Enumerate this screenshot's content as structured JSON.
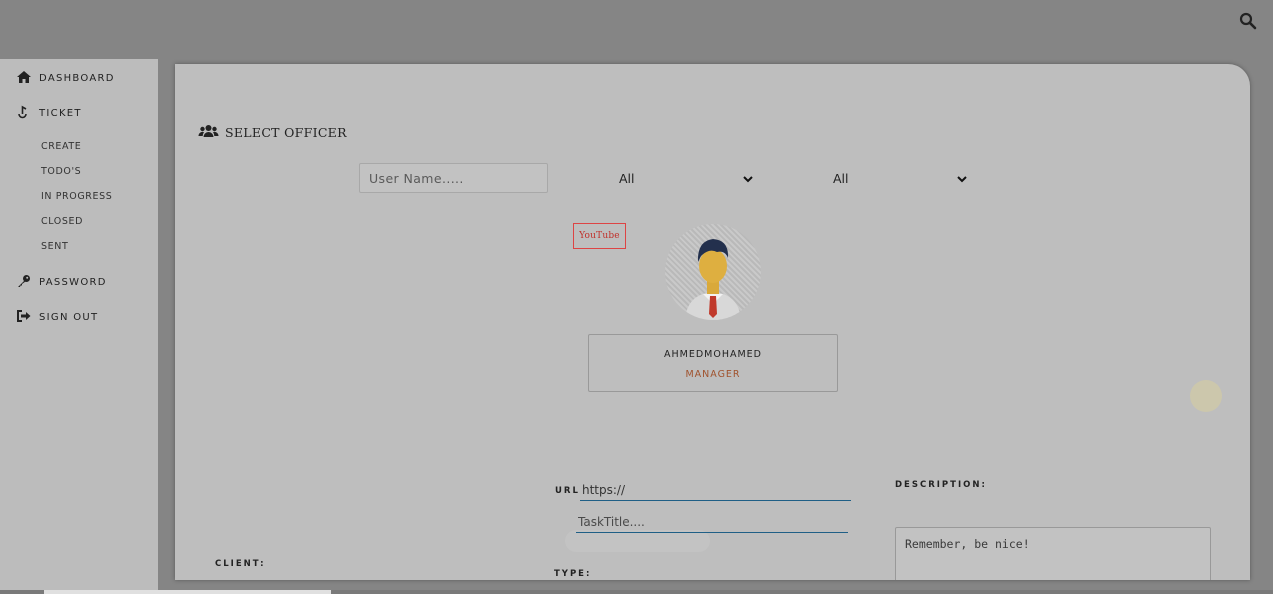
{
  "sidebar": {
    "dashboard": "DASHBOARD",
    "ticket": "TICKET",
    "ticket_items": [
      "CREATE",
      "TODO'S",
      "IN PROGRESS",
      "CLOSED",
      "SENT"
    ],
    "password": "PASSWORD",
    "sign_out": "SIGN OUT"
  },
  "main": {
    "title": "SELECT OFFICER",
    "username_placeholder": "User Name.....",
    "filter1_value": "All",
    "filter2_value": "All",
    "badge": "YouTube",
    "profile": {
      "name": "AHMEDMOHAMED",
      "role": "MANAGER"
    },
    "url_label": "URL",
    "url_value": "https://",
    "task_placeholder": "TaskTitle....",
    "description_label": "DESCRIPTION:",
    "description_placeholder": "Remember, be nice!",
    "client_label": "CLIENT:",
    "type_label": "TYPE:"
  },
  "icons": {
    "search": "search-icon",
    "home": "home-icon",
    "ticket": "ticket-icon",
    "key": "key-icon",
    "signout": "sign-out-icon",
    "users": "users-icon"
  }
}
